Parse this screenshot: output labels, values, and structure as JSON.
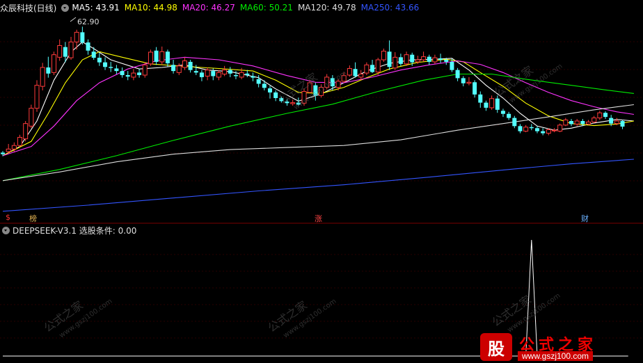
{
  "header": {
    "stock_title": "众辰科技(日线)",
    "ma_labels": [
      {
        "text": "MA5: 43.91",
        "color": "#ffffff"
      },
      {
        "text": "MA10: 44.98",
        "color": "#ffff00"
      },
      {
        "text": "MA20: 46.27",
        "color": "#ff33ff"
      },
      {
        "text": "MA60: 50.21",
        "color": "#00ee00"
      },
      {
        "text": "MA120: 49.78",
        "color": "#dddddd"
      },
      {
        "text": "MA250: 43.66",
        "color": "#3355ff"
      }
    ]
  },
  "indicator": {
    "label": "DEEPSEEK-V3.1  选股条件: 0.00"
  },
  "markers": {
    "dollar": "$",
    "bang": "榜",
    "zhang": "涨",
    "cai": "财"
  },
  "peak_label": "62.90",
  "watermarks": [
    "公式之家",
    "www.gszj100.com"
  ],
  "logo": {
    "mark": "股",
    "title": "公式之家",
    "url": "www.gszj100.com"
  },
  "chart_data": {
    "type": "candlestick",
    "price_panel_range": [
      33,
      66
    ],
    "candles": [
      [
        38.8,
        38.5,
        39.1,
        38.1
      ],
      [
        39.0,
        39.5,
        40.5,
        38.6
      ],
      [
        39.5,
        40.2,
        40.8,
        39.0
      ],
      [
        40.2,
        41.8,
        42.3,
        39.9
      ],
      [
        41.5,
        44.5,
        45.0,
        41.0
      ],
      [
        44.0,
        47.5,
        48.2,
        43.6
      ],
      [
        47.5,
        52.0,
        53.0,
        46.8
      ],
      [
        51.8,
        55.5,
        56.4,
        51.0
      ],
      [
        55.5,
        54.3,
        57.6,
        53.5
      ],
      [
        54.5,
        58.0,
        58.6,
        54.0
      ],
      [
        57.5,
        59.8,
        61.0,
        56.8
      ],
      [
        59.5,
        57.6,
        60.5,
        56.5
      ],
      [
        57.4,
        60.5,
        61.5,
        57.0
      ],
      [
        60.5,
        62.4,
        62.9,
        59.0
      ],
      [
        62.4,
        60.4,
        63.5,
        60.0
      ],
      [
        60.4,
        58.8,
        61.0,
        58.0
      ],
      [
        58.6,
        57.4,
        59.5,
        57.0
      ],
      [
        57.4,
        56.5,
        58.4,
        55.8
      ],
      [
        56.5,
        55.6,
        57.5,
        55.0
      ],
      [
        55.6,
        55.4,
        56.6,
        54.6
      ],
      [
        55.3,
        54.8,
        56.0,
        54.2
      ],
      [
        54.8,
        54.0,
        55.5,
        53.5
      ],
      [
        54.0,
        53.7,
        54.8,
        53.0
      ],
      [
        53.6,
        54.4,
        55.2,
        53.0
      ],
      [
        54.5,
        54.0,
        55.2,
        53.5
      ],
      [
        54.0,
        56.0,
        56.5,
        53.5
      ],
      [
        56.2,
        58.5,
        59.0,
        55.8
      ],
      [
        58.8,
        56.6,
        59.5,
        56.0
      ],
      [
        56.6,
        58.6,
        59.6,
        56.0
      ],
      [
        58.6,
        56.3,
        59.0,
        55.7
      ],
      [
        56.0,
        54.8,
        57.0,
        54.3
      ],
      [
        54.5,
        55.8,
        56.3,
        54.0
      ],
      [
        55.5,
        56.8,
        57.5,
        55.0
      ],
      [
        56.6,
        55.0,
        57.0,
        54.5
      ],
      [
        54.8,
        54.5,
        56.0,
        54.0
      ],
      [
        54.5,
        53.6,
        55.0,
        52.8
      ],
      [
        53.8,
        55.0,
        55.5,
        53.0
      ],
      [
        54.8,
        53.8,
        55.3,
        53.0
      ],
      [
        53.6,
        54.5,
        55.0,
        53.0
      ],
      [
        54.2,
        55.0,
        55.8,
        53.8
      ],
      [
        55.0,
        54.3,
        55.6,
        53.6
      ],
      [
        54.0,
        53.8,
        54.8,
        53.2
      ],
      [
        53.6,
        54.5,
        55.4,
        53.2
      ],
      [
        54.3,
        54.0,
        55.0,
        53.6
      ],
      [
        53.8,
        53.5,
        54.5,
        52.8
      ],
      [
        53.2,
        52.3,
        54.0,
        51.6
      ],
      [
        52.3,
        51.5,
        53.0,
        51.0
      ],
      [
        51.4,
        50.6,
        51.9,
        49.4
      ],
      [
        50.6,
        49.5,
        51.0,
        48.9
      ],
      [
        49.5,
        48.9,
        49.8,
        48.6
      ],
      [
        48.8,
        48.5,
        49.3,
        48.0
      ],
      [
        48.4,
        48.6,
        49.2,
        48.0
      ],
      [
        48.6,
        48.2,
        49.6,
        48.0
      ],
      [
        48.5,
        50.8,
        51.4,
        48.0
      ],
      [
        50.6,
        52.5,
        53.0,
        50.5
      ],
      [
        52.0,
        50.0,
        52.5,
        49.0
      ],
      [
        50.0,
        51.6,
        52.2,
        49.6
      ],
      [
        51.6,
        53.6,
        54.2,
        51.2
      ],
      [
        53.4,
        51.8,
        54.0,
        51.0
      ],
      [
        51.6,
        52.8,
        53.2,
        51.0
      ],
      [
        52.8,
        53.9,
        54.5,
        52.5
      ],
      [
        54.0,
        55.3,
        55.9,
        53.7
      ],
      [
        55.2,
        53.8,
        56.5,
        53.5
      ],
      [
        53.6,
        54.2,
        55.0,
        53.0
      ],
      [
        54.4,
        56.0,
        56.5,
        54.0
      ],
      [
        56.0,
        54.6,
        57.0,
        54.4
      ],
      [
        54.6,
        57.0,
        57.4,
        54.0
      ],
      [
        57.0,
        58.7,
        59.2,
        56.6
      ],
      [
        58.6,
        55.6,
        60.8,
        55.0
      ],
      [
        55.4,
        57.5,
        58.5,
        55.0
      ],
      [
        57.5,
        56.2,
        58.2,
        55.8
      ],
      [
        56.2,
        58.0,
        58.6,
        55.8
      ],
      [
        58.0,
        56.5,
        58.4,
        55.8
      ],
      [
        56.6,
        57.0,
        57.8,
        56.2
      ],
      [
        57.0,
        57.6,
        58.6,
        56.6
      ],
      [
        57.6,
        56.6,
        58.0,
        56.0
      ],
      [
        56.6,
        57.4,
        58.0,
        56.2
      ],
      [
        57.3,
        57.0,
        58.2,
        56.4
      ],
      [
        57.0,
        56.6,
        57.4,
        56.0
      ],
      [
        56.6,
        55.0,
        57.2,
        54.6
      ],
      [
        55.0,
        53.4,
        55.4,
        52.8
      ],
      [
        53.4,
        52.4,
        53.8,
        51.8
      ],
      [
        52.4,
        52.6,
        53.6,
        52.0
      ],
      [
        52.6,
        50.2,
        53.0,
        49.6
      ],
      [
        50.2,
        48.6,
        50.8,
        47.6
      ],
      [
        48.6,
        47.6,
        49.0,
        47.0
      ],
      [
        47.6,
        49.4,
        50.0,
        47.2
      ],
      [
        49.4,
        47.2,
        50.0,
        46.6
      ],
      [
        47.0,
        46.4,
        47.4,
        45.8
      ],
      [
        46.4,
        45.6,
        46.8,
        45.2
      ],
      [
        45.6,
        44.0,
        46.0,
        43.6
      ],
      [
        44.0,
        43.0,
        44.4,
        42.6
      ],
      [
        43.0,
        43.8,
        44.2,
        42.8
      ],
      [
        43.8,
        43.6,
        44.4,
        43.2
      ],
      [
        43.6,
        43.0,
        44.0,
        42.6
      ],
      [
        43.0,
        42.6,
        43.6,
        42.2
      ],
      [
        42.6,
        43.3,
        43.6,
        42.2
      ],
      [
        43.2,
        43.2,
        43.6,
        42.8
      ],
      [
        43.0,
        44.2,
        44.5,
        42.8
      ],
      [
        44.2,
        45.2,
        45.6,
        44.0
      ],
      [
        45.0,
        44.4,
        45.4,
        44.0
      ],
      [
        44.4,
        45.0,
        45.4,
        44.0
      ],
      [
        45.0,
        44.4,
        45.4,
        44.0
      ],
      [
        44.4,
        44.8,
        45.2,
        44.2
      ],
      [
        44.8,
        45.6,
        46.0,
        44.6
      ],
      [
        45.6,
        46.6,
        47.0,
        45.2
      ],
      [
        46.6,
        45.8,
        46.9,
        45.4
      ],
      [
        45.6,
        44.5,
        46.2,
        44.0
      ],
      [
        44.5,
        45.0,
        45.6,
        44.2
      ],
      [
        45.0,
        43.9,
        45.2,
        43.4
      ]
    ],
    "ma_series": [
      {
        "name": "MA5",
        "color": "#ffffff",
        "points": [
          [
            0,
            38.2
          ],
          [
            3,
            40
          ],
          [
            6,
            45
          ],
          [
            9,
            53
          ],
          [
            12,
            58.5
          ],
          [
            14,
            60.5
          ],
          [
            16,
            59.2
          ],
          [
            19,
            57
          ],
          [
            24,
            55.2
          ],
          [
            28,
            55.5
          ],
          [
            32,
            56
          ],
          [
            36,
            55
          ],
          [
            40,
            54.7
          ],
          [
            45,
            53.5
          ],
          [
            48,
            51.3
          ],
          [
            52,
            48.9
          ],
          [
            56,
            50.3
          ],
          [
            60,
            52.5
          ],
          [
            64,
            54.8
          ],
          [
            68,
            56.3
          ],
          [
            72,
            57
          ],
          [
            76,
            57.1
          ],
          [
            79,
            57.3
          ],
          [
            82,
            55
          ],
          [
            85,
            52
          ],
          [
            88,
            49.5
          ],
          [
            91,
            46.5
          ],
          [
            94,
            44
          ],
          [
            97,
            43.2
          ],
          [
            100,
            43.6
          ],
          [
            104,
            44.6
          ],
          [
            108,
            45.3
          ],
          [
            111,
            45
          ]
        ]
      },
      {
        "name": "MA10",
        "color": "#ffff00",
        "points": [
          [
            0,
            38.2
          ],
          [
            5,
            41
          ],
          [
            8,
            46.5
          ],
          [
            11,
            52.5
          ],
          [
            14,
            57
          ],
          [
            17,
            58.6
          ],
          [
            21,
            57.5
          ],
          [
            26,
            56.2
          ],
          [
            32,
            55.7
          ],
          [
            38,
            55.3
          ],
          [
            44,
            54.8
          ],
          [
            48,
            53
          ],
          [
            52,
            50.6
          ],
          [
            56,
            50.4
          ],
          [
            60,
            51.6
          ],
          [
            64,
            53.5
          ],
          [
            68,
            55.2
          ],
          [
            73,
            56.5
          ],
          [
            78,
            57.1
          ],
          [
            81,
            56.6
          ],
          [
            84,
            54.5
          ],
          [
            88,
            51.8
          ],
          [
            92,
            48.5
          ],
          [
            96,
            46
          ],
          [
            100,
            44.5
          ],
          [
            104,
            44.1
          ],
          [
            108,
            44.4
          ],
          [
            111,
            45
          ]
        ]
      },
      {
        "name": "MA20",
        "color": "#ff33ff",
        "points": [
          [
            0,
            38.2
          ],
          [
            5,
            40
          ],
          [
            9,
            44
          ],
          [
            13,
            49
          ],
          [
            17,
            52.5
          ],
          [
            22,
            55.2
          ],
          [
            27,
            56.8
          ],
          [
            32,
            57.5
          ],
          [
            38,
            57
          ],
          [
            44,
            55.8
          ],
          [
            50,
            53.9
          ],
          [
            55,
            52.6
          ],
          [
            60,
            52.5
          ],
          [
            65,
            53.6
          ],
          [
            70,
            55
          ],
          [
            75,
            56
          ],
          [
            80,
            56.8
          ],
          [
            84,
            56.1
          ],
          [
            88,
            54.5
          ],
          [
            92,
            52.5
          ],
          [
            96,
            50.6
          ],
          [
            100,
            49
          ],
          [
            104,
            47.8
          ],
          [
            108,
            46.8
          ],
          [
            111,
            46.3
          ]
        ]
      },
      {
        "name": "MA60",
        "color": "#00ee00",
        "points": [
          [
            0,
            33.3
          ],
          [
            10,
            35.5
          ],
          [
            20,
            38.2
          ],
          [
            30,
            41.2
          ],
          [
            40,
            44
          ],
          [
            50,
            46.5
          ],
          [
            58,
            48.3
          ],
          [
            66,
            50.8
          ],
          [
            74,
            53
          ],
          [
            80,
            54.2
          ],
          [
            86,
            54.2
          ],
          [
            92,
            53.2
          ],
          [
            100,
            52
          ],
          [
            106,
            51.1
          ],
          [
            111,
            50.4
          ]
        ]
      },
      {
        "name": "MA120",
        "color": "#dddddd",
        "points": [
          [
            0,
            33.3
          ],
          [
            10,
            35
          ],
          [
            20,
            37
          ],
          [
            30,
            38.5
          ],
          [
            40,
            39.4
          ],
          [
            50,
            39.8
          ],
          [
            60,
            40.2
          ],
          [
            70,
            41.3
          ],
          [
            80,
            43.2
          ],
          [
            88,
            44.5
          ],
          [
            96,
            45.8
          ],
          [
            104,
            47.2
          ],
          [
            111,
            48.2
          ]
        ]
      },
      {
        "name": "MA250",
        "color": "#3355ff",
        "points": [
          [
            0,
            27.3
          ],
          [
            15,
            28.5
          ],
          [
            30,
            29.9
          ],
          [
            45,
            31.3
          ],
          [
            60,
            32.5
          ],
          [
            75,
            34.0
          ],
          [
            90,
            35.6
          ],
          [
            100,
            36.6
          ],
          [
            111,
            37.5
          ]
        ]
      }
    ],
    "indicator_series": {
      "name": "选股条件",
      "values": [
        0,
        0,
        0,
        0,
        0,
        0,
        0,
        0,
        0,
        0,
        0,
        0,
        0,
        0,
        0,
        0,
        0,
        0,
        0,
        0,
        0,
        0,
        0,
        0,
        0,
        0,
        0,
        0,
        0,
        0,
        0,
        0,
        0,
        0,
        0,
        0,
        0,
        0,
        0,
        0,
        0,
        0,
        0,
        0,
        0,
        0,
        0,
        0,
        0,
        0,
        0,
        0,
        0,
        0,
        0,
        0,
        0,
        0,
        0,
        0,
        0,
        0,
        0,
        0,
        0,
        0,
        0,
        0,
        0,
        0,
        0,
        0,
        0,
        0,
        0,
        0,
        0,
        0,
        0,
        0,
        0,
        0,
        0,
        0,
        0,
        0,
        0,
        0,
        0,
        0,
        0,
        0,
        0,
        1,
        0,
        0,
        0,
        0,
        0,
        0,
        0,
        0,
        0,
        0,
        0,
        0,
        0,
        0,
        0,
        0,
        0
      ],
      "ylim": [
        0,
        1
      ]
    }
  }
}
